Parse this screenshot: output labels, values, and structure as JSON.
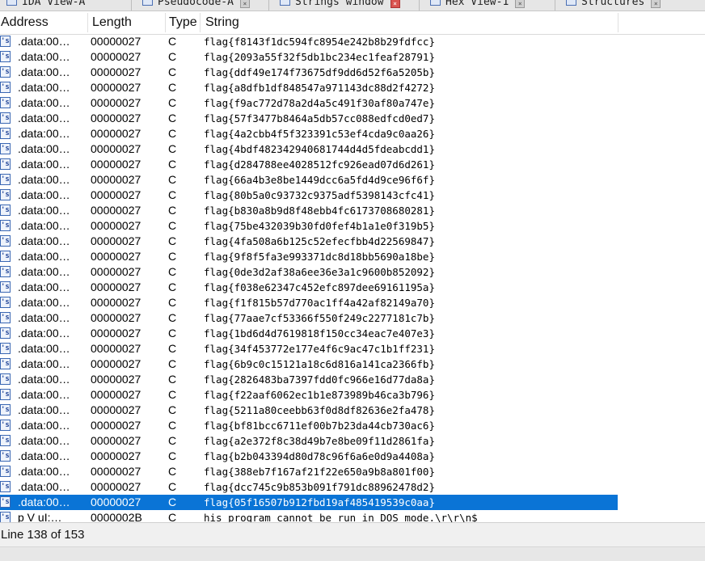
{
  "tabs": [
    {
      "label": "IDA View-A",
      "active": false
    },
    {
      "label": "Pseudocode-A",
      "active": false
    },
    {
      "label": "Strings window",
      "active": true
    },
    {
      "label": "Hex View-1",
      "active": false
    },
    {
      "label": "Structures",
      "active": false
    }
  ],
  "columns": {
    "address": "Address",
    "length": "Length",
    "type": "Type",
    "string": "String"
  },
  "rows": [
    {
      "address": ".data:00…",
      "length": "00000027",
      "type": "C",
      "string": "flag{f8143f1dc594fc8954e242b8b29fdfcc}"
    },
    {
      "address": ".data:00…",
      "length": "00000027",
      "type": "C",
      "string": "flag{2093a55f32f5db1bc234ec1feaf28791}"
    },
    {
      "address": ".data:00…",
      "length": "00000027",
      "type": "C",
      "string": "flag{ddf49e174f73675df9dd6d52f6a5205b}"
    },
    {
      "address": ".data:00…",
      "length": "00000027",
      "type": "C",
      "string": "flag{a8dfb1df848547a971143dc88d2f4272}"
    },
    {
      "address": ".data:00…",
      "length": "00000027",
      "type": "C",
      "string": "flag{f9ac772d78a2d4a5c491f30af80a747e}"
    },
    {
      "address": ".data:00…",
      "length": "00000027",
      "type": "C",
      "string": "flag{57f3477b8464a5db57cc088edfcd0ed7}"
    },
    {
      "address": ".data:00…",
      "length": "00000027",
      "type": "C",
      "string": "flag{4a2cbb4f5f323391c53ef4cda9c0aa26}"
    },
    {
      "address": ".data:00…",
      "length": "00000027",
      "type": "C",
      "string": "flag{4bdf482342940681744d4d5fdeabcdd1}"
    },
    {
      "address": ".data:00…",
      "length": "00000027",
      "type": "C",
      "string": "flag{d284788ee4028512fc926ead07d6d261}"
    },
    {
      "address": ".data:00…",
      "length": "00000027",
      "type": "C",
      "string": "flag{66a4b3e8be1449dcc6a5fd4d9ce96f6f}"
    },
    {
      "address": ".data:00…",
      "length": "00000027",
      "type": "C",
      "string": "flag{80b5a0c93732c9375adf5398143cfc41}"
    },
    {
      "address": ".data:00…",
      "length": "00000027",
      "type": "C",
      "string": "flag{b830a8b9d8f48ebb4fc6173708680281}"
    },
    {
      "address": ".data:00…",
      "length": "00000027",
      "type": "C",
      "string": "flag{75be432039b30fd0fef4b1a1e0f319b5}"
    },
    {
      "address": ".data:00…",
      "length": "00000027",
      "type": "C",
      "string": "flag{4fa508a6b125c52efecfbb4d22569847}"
    },
    {
      "address": ".data:00…",
      "length": "00000027",
      "type": "C",
      "string": "flag{9f8f5fa3e993371dc8d18bb5690a18be}"
    },
    {
      "address": ".data:00…",
      "length": "00000027",
      "type": "C",
      "string": "flag{0de3d2af38a6ee36e3a1c9600b852092}"
    },
    {
      "address": ".data:00…",
      "length": "00000027",
      "type": "C",
      "string": "flag{f038e62347c452efc897dee69161195a}"
    },
    {
      "address": ".data:00…",
      "length": "00000027",
      "type": "C",
      "string": "flag{f1f815b57d770ac1ff4a42af82149a70}"
    },
    {
      "address": ".data:00…",
      "length": "00000027",
      "type": "C",
      "string": "flag{77aae7cf53366f550f249c2277181c7b}"
    },
    {
      "address": ".data:00…",
      "length": "00000027",
      "type": "C",
      "string": "flag{1bd6d4d7619818f150cc34eac7e407e3}"
    },
    {
      "address": ".data:00…",
      "length": "00000027",
      "type": "C",
      "string": "flag{34f453772e177e4f6c9ac47c1b1ff231}"
    },
    {
      "address": ".data:00…",
      "length": "00000027",
      "type": "C",
      "string": "flag{6b9c0c15121a18c6d816a141ca2366fb}"
    },
    {
      "address": ".data:00…",
      "length": "00000027",
      "type": "C",
      "string": "flag{2826483ba7397fdd0fc966e16d77da8a}"
    },
    {
      "address": ".data:00…",
      "length": "00000027",
      "type": "C",
      "string": "flag{f22aaf6062ec1b1e873989b46ca3b796}"
    },
    {
      "address": ".data:00…",
      "length": "00000027",
      "type": "C",
      "string": "flag{5211a80ceebb63f0d8df82636e2fa478}"
    },
    {
      "address": ".data:00…",
      "length": "00000027",
      "type": "C",
      "string": "flag{bf81bcc6711ef00b7b23da44cb730ac6}"
    },
    {
      "address": ".data:00…",
      "length": "00000027",
      "type": "C",
      "string": "flag{a2e372f8c38d49b7e8be09f11d2861fa}"
    },
    {
      "address": ".data:00…",
      "length": "00000027",
      "type": "C",
      "string": "flag{b2b043394d80d78c96f6a6e0d9a4408a}"
    },
    {
      "address": ".data:00…",
      "length": "00000027",
      "type": "C",
      "string": "flag{388eb7f167af21f22e650a9b8a801f00}"
    },
    {
      "address": ".data:00…",
      "length": "00000027",
      "type": "C",
      "string": "flag{dcc745c9b853b091f791dc88962478d2}"
    },
    {
      "address": ".data:00…",
      "length": "00000027",
      "type": "C",
      "string": "flag{05f16507b912fbd19af485419539c0aa}",
      "selected": true
    },
    {
      "address": "p V uI:…",
      "length": "0000002B",
      "type": "C",
      "string": "his program cannot be run in DOS mode.\\r\\r\\n$"
    }
  ],
  "status": {
    "line_text": "Line 138 of 153"
  },
  "colors": {
    "selection": "#0a74d6",
    "string_icon_border": "#3a67b3"
  },
  "icons": {
    "row_icon": "string-icon"
  }
}
